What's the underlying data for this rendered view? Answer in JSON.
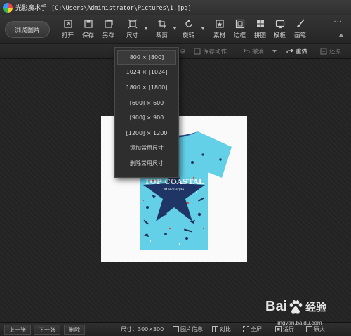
{
  "window": {
    "app_name": "光影魔术手",
    "file_path": "[C:\\Users\\Administrator\\Pictures\\1.jpg]"
  },
  "toolbar": {
    "browse_label": "浏览图片",
    "tools": {
      "open": "打开",
      "save": "保存",
      "save_as": "另存",
      "size": "尺寸",
      "crop": "裁剪",
      "rotate": "旋转",
      "material": "素材",
      "border": "边框",
      "collage": "拼图",
      "template": "模板",
      "brush": "画笔"
    },
    "more": "···"
  },
  "subbar": {
    "share": "享",
    "save_action": "保存动作",
    "undo": "撤消",
    "redo": "重做",
    "restore": "还原"
  },
  "size_menu": {
    "items": [
      "800 × [800]",
      "1024 × [1024]",
      "1800 × [1800]",
      "[600] × 600",
      "[900] × 900",
      "[1200] × 1200",
      "添加常用尺寸",
      "删除常用尺寸"
    ],
    "highlighted_index": 0
  },
  "photo": {
    "shirt_text": "TOP COASTAL",
    "shirt_subtext": "Men's style",
    "shirt_color": "#63d0e8"
  },
  "statusbar": {
    "prev": "上一张",
    "next": "下一张",
    "delete": "删除",
    "size_info": "尺寸：300×300",
    "image_info": "图片信息",
    "compare": "对比",
    "fullscreen": "全屏",
    "fit": "适屏",
    "zoom_in": "原大"
  },
  "watermark": {
    "brand_left": "Bai",
    "brand_right": "经验",
    "url": "jingyan.baidu.com"
  }
}
